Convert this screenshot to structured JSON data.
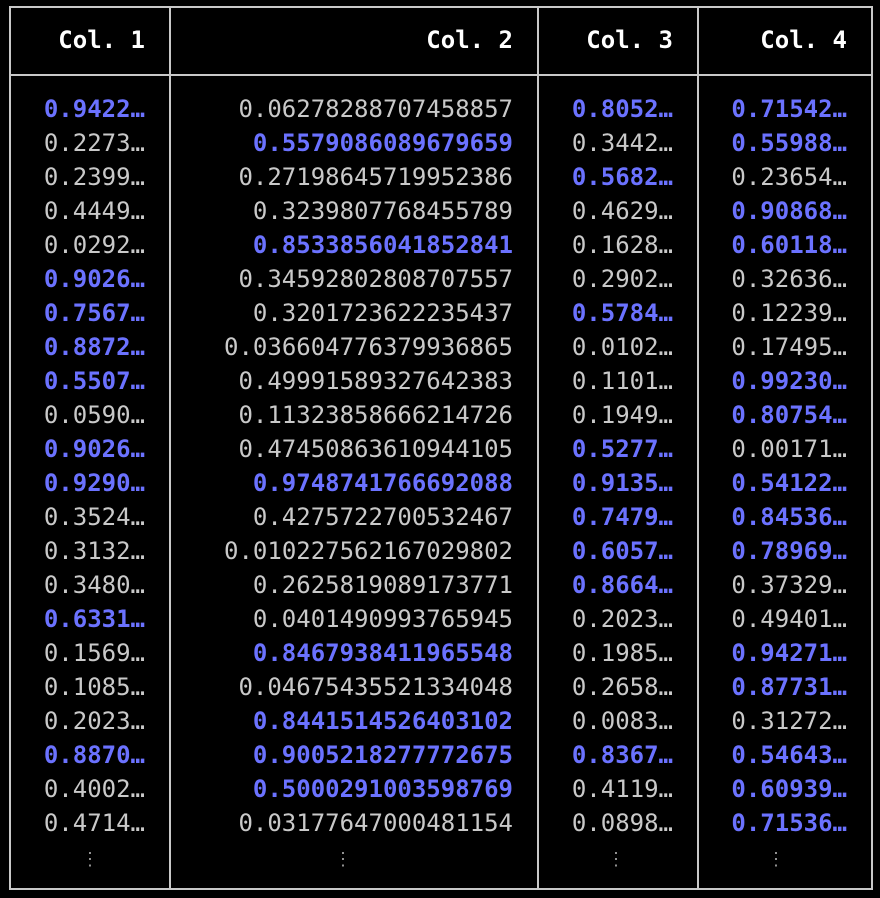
{
  "columns": [
    {
      "header": "Col. 1",
      "ellipsis": "⋮",
      "cells": [
        {
          "text": "0.9422…",
          "hl": true
        },
        {
          "text": "0.2273…",
          "hl": false
        },
        {
          "text": "0.2399…",
          "hl": false
        },
        {
          "text": "0.4449…",
          "hl": false
        },
        {
          "text": "0.0292…",
          "hl": false
        },
        {
          "text": "0.9026…",
          "hl": true
        },
        {
          "text": "0.7567…",
          "hl": true
        },
        {
          "text": "0.8872…",
          "hl": true
        },
        {
          "text": "0.5507…",
          "hl": true
        },
        {
          "text": "0.0590…",
          "hl": false
        },
        {
          "text": "0.9026…",
          "hl": true
        },
        {
          "text": "0.9290…",
          "hl": true
        },
        {
          "text": "0.3524…",
          "hl": false
        },
        {
          "text": "0.3132…",
          "hl": false
        },
        {
          "text": "0.3480…",
          "hl": false
        },
        {
          "text": "0.6331…",
          "hl": true
        },
        {
          "text": "0.1569…",
          "hl": false
        },
        {
          "text": "0.1085…",
          "hl": false
        },
        {
          "text": "0.2023…",
          "hl": false
        },
        {
          "text": "0.8870…",
          "hl": true
        },
        {
          "text": "0.4002…",
          "hl": false
        },
        {
          "text": "0.4714…",
          "hl": false
        }
      ]
    },
    {
      "header": "Col. 2",
      "ellipsis": "⋮",
      "cells": [
        {
          "text": "0.06278288707458857",
          "hl": false
        },
        {
          "text": "0.5579086089679659",
          "hl": true
        },
        {
          "text": "0.27198645719952386",
          "hl": false
        },
        {
          "text": "0.3239807768455789",
          "hl": false
        },
        {
          "text": "0.8533856041852841",
          "hl": true
        },
        {
          "text": "0.34592802808707557",
          "hl": false
        },
        {
          "text": "0.3201723622235437",
          "hl": false
        },
        {
          "text": "0.036604776379936865",
          "hl": false
        },
        {
          "text": "0.49991589327642383",
          "hl": false
        },
        {
          "text": "0.11323858666214726",
          "hl": false
        },
        {
          "text": "0.47450863610944105",
          "hl": false
        },
        {
          "text": "0.9748741766692088",
          "hl": true
        },
        {
          "text": "0.4275722700532467",
          "hl": false
        },
        {
          "text": "0.010227562167029802",
          "hl": false
        },
        {
          "text": "0.2625819089173771",
          "hl": false
        },
        {
          "text": "0.0401490993765945",
          "hl": false
        },
        {
          "text": "0.8467938411965548",
          "hl": true
        },
        {
          "text": "0.04675435521334048",
          "hl": false
        },
        {
          "text": "0.8441514526403102",
          "hl": true
        },
        {
          "text": "0.9005218277772675",
          "hl": true
        },
        {
          "text": "0.5000291003598769",
          "hl": true
        },
        {
          "text": "0.03177647000481154",
          "hl": false
        }
      ]
    },
    {
      "header": "Col. 3",
      "ellipsis": "⋮",
      "cells": [
        {
          "text": "0.8052…",
          "hl": true
        },
        {
          "text": "0.3442…",
          "hl": false
        },
        {
          "text": "0.5682…",
          "hl": true
        },
        {
          "text": "0.4629…",
          "hl": false
        },
        {
          "text": "0.1628…",
          "hl": false
        },
        {
          "text": "0.2902…",
          "hl": false
        },
        {
          "text": "0.5784…",
          "hl": true
        },
        {
          "text": "0.0102…",
          "hl": false
        },
        {
          "text": "0.1101…",
          "hl": false
        },
        {
          "text": "0.1949…",
          "hl": false
        },
        {
          "text": "0.5277…",
          "hl": true
        },
        {
          "text": "0.9135…",
          "hl": true
        },
        {
          "text": "0.7479…",
          "hl": true
        },
        {
          "text": "0.6057…",
          "hl": true
        },
        {
          "text": "0.8664…",
          "hl": true
        },
        {
          "text": "0.2023…",
          "hl": false
        },
        {
          "text": "0.1985…",
          "hl": false
        },
        {
          "text": "0.2658…",
          "hl": false
        },
        {
          "text": "0.0083…",
          "hl": false
        },
        {
          "text": "0.8367…",
          "hl": true
        },
        {
          "text": "0.4119…",
          "hl": false
        },
        {
          "text": "0.0898…",
          "hl": false
        }
      ]
    },
    {
      "header": "Col. 4",
      "ellipsis": "⋮",
      "cells": [
        {
          "text": "0.71542…",
          "hl": true
        },
        {
          "text": "0.55988…",
          "hl": true
        },
        {
          "text": "0.23654…",
          "hl": false
        },
        {
          "text": "0.90868…",
          "hl": true
        },
        {
          "text": "0.60118…",
          "hl": true
        },
        {
          "text": "0.32636…",
          "hl": false
        },
        {
          "text": "0.12239…",
          "hl": false
        },
        {
          "text": "0.17495…",
          "hl": false
        },
        {
          "text": "0.99230…",
          "hl": true
        },
        {
          "text": "0.80754…",
          "hl": true
        },
        {
          "text": "0.00171…",
          "hl": false
        },
        {
          "text": "0.54122…",
          "hl": true
        },
        {
          "text": "0.84536…",
          "hl": true
        },
        {
          "text": "0.78969…",
          "hl": true
        },
        {
          "text": "0.37329…",
          "hl": false
        },
        {
          "text": "0.49401…",
          "hl": false
        },
        {
          "text": "0.94271…",
          "hl": true
        },
        {
          "text": "0.87731…",
          "hl": true
        },
        {
          "text": "0.31272…",
          "hl": false
        },
        {
          "text": "0.54643…",
          "hl": true
        },
        {
          "text": "0.60939…",
          "hl": true
        },
        {
          "text": "0.71536…",
          "hl": true
        }
      ]
    }
  ],
  "colors": {
    "highlight": "#6b72ff",
    "normal": "#c9c9c9",
    "header": "#ffffff",
    "border": "#c9c9c9",
    "background": "#000000"
  }
}
